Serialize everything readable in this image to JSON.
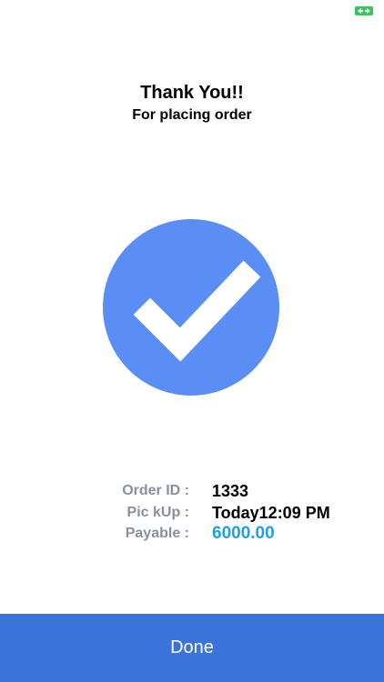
{
  "header": {
    "title": "Thank You!!",
    "subtitle": "For placing order"
  },
  "order": {
    "order_id_label": "Order ID :",
    "order_id": "1333",
    "pickup_label": "Pic kUp :",
    "pickup": "Today12:09 PM",
    "payable_label": "Payable :",
    "payable": "6000.00"
  },
  "actions": {
    "done_label": "Done"
  },
  "icons": {
    "status": "arrows-icon",
    "success": "checkmark-icon"
  },
  "colors": {
    "accent": "#3b73db",
    "success_circle": "#5b8ef5",
    "amount": "#1ea0e6",
    "label_gray": "#8a8f9c",
    "status_green": "#34c759"
  }
}
